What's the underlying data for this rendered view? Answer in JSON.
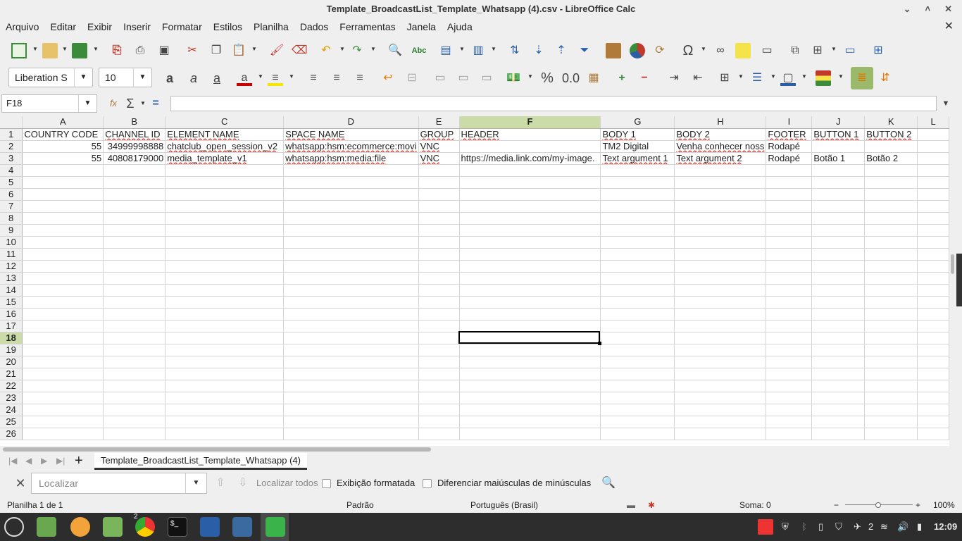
{
  "window": {
    "title": "Template_BroadcastList_Template_Whatsapp (4).csv - LibreOffice Calc"
  },
  "menu": [
    "Arquivo",
    "Editar",
    "Exibir",
    "Inserir",
    "Formatar",
    "Estilos",
    "Planilha",
    "Dados",
    "Ferramentas",
    "Janela",
    "Ajuda"
  ],
  "format": {
    "font_name": "Liberation S",
    "font_size": "10"
  },
  "formula": {
    "cell_ref": "F18",
    "value": ""
  },
  "sheet": {
    "columns": [
      "A",
      "B",
      "C",
      "D",
      "E",
      "F",
      "G",
      "H",
      "I",
      "J",
      "K",
      "L"
    ],
    "rows": [
      [
        "COUNTRY CODE",
        "CHANNEL ID",
        "ELEMENT NAME",
        "SPACE NAME",
        "GROUP",
        "HEADER",
        "BODY 1",
        "BODY 2",
        "FOOTER",
        "BUTTON 1",
        "BUTTON 2",
        ""
      ],
      [
        "55",
        "34999998888",
        "chatclub_open_session_v2",
        "whatsapp:hsm:ecommerce:movi",
        "VNC",
        "",
        "TM2 Digital",
        "Venha conhecer noss",
        "Rodapé",
        "",
        "",
        ""
      ],
      [
        "55",
        "40808179000",
        "media_template_v1",
        "whatsapp:hsm:media:file",
        "VNC",
        "https://media.link.com/my-image.",
        "Text argument 1",
        " Text argument 2",
        "Rodapé",
        "Botão 1",
        " Botão 2",
        ""
      ]
    ],
    "row_numbers": [
      "1",
      "2",
      "3",
      "4",
      "5",
      "6",
      "7",
      "8",
      "9",
      "10",
      "11",
      "12",
      "13",
      "14",
      "15",
      "16",
      "17",
      "18",
      "19",
      "20",
      "21",
      "22",
      "23",
      "24",
      "25",
      "26"
    ],
    "selected_row": "18",
    "selected_col": "F"
  },
  "tabs": {
    "active": "Template_BroadcastList_Template_Whatsapp (4)"
  },
  "find": {
    "placeholder": "Localizar",
    "find_all": "Localizar todos",
    "formatted": "Exibição formatada",
    "match_case": "Diferenciar maiúsculas de minúsculas"
  },
  "status": {
    "sheet": "Planilha 1 de 1",
    "style": "Padrão",
    "language": "Português (Brasil)",
    "sum": "Soma: 0",
    "zoom": "100%"
  },
  "taskbar": {
    "badge": "2",
    "tray_count": "2",
    "clock": "12:09"
  },
  "colors": {
    "selection_header": "#ccdca8",
    "spell_underline": "#d93025",
    "taskbar": "#2d2d2d",
    "calc_green": "#3ab44a"
  }
}
